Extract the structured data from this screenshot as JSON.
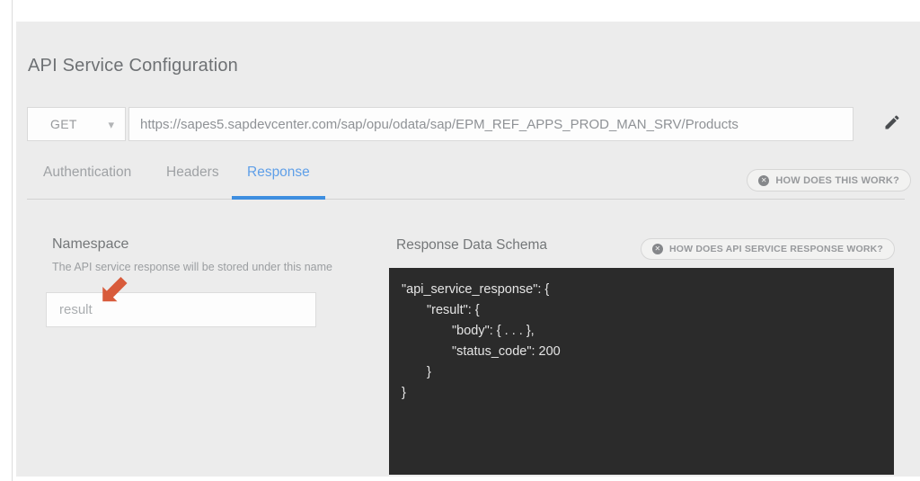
{
  "page": {
    "title": "API Service Configuration"
  },
  "request": {
    "method": "GET",
    "url": "https://sapes5.sapdevcenter.com/sap/opu/odata/sap/EPM_REF_APPS_PROD_MAN_SRV/Products"
  },
  "tabs": {
    "items": [
      {
        "label": "Authentication",
        "active": false
      },
      {
        "label": "Headers",
        "active": false
      },
      {
        "label": "Response",
        "active": true
      }
    ],
    "help_button": {
      "label": "HOW DOES THIS WORK?"
    }
  },
  "namespace": {
    "title": "Namespace",
    "description": "The API service response will be stored under this name",
    "input_placeholder": "result"
  },
  "schema": {
    "title": "Response Data Schema",
    "help_button": {
      "label": "HOW DOES API SERVICE RESPONSE WORK?"
    },
    "code_lines": [
      "\"api_service_response\": {",
      "\"result\": {",
      "\"body\": { . . . },",
      "\"status_code\": 200",
      "}",
      "}"
    ]
  },
  "icons": {
    "chevron_down": "▾",
    "help_badge": "✕"
  },
  "colors": {
    "accent_blue": "#3e8ee0",
    "active_tab_text": "#5f9fe8",
    "annotation_arrow": "#d85b3b",
    "code_background": "#2b2b2b",
    "panel_background": "#ececec"
  }
}
